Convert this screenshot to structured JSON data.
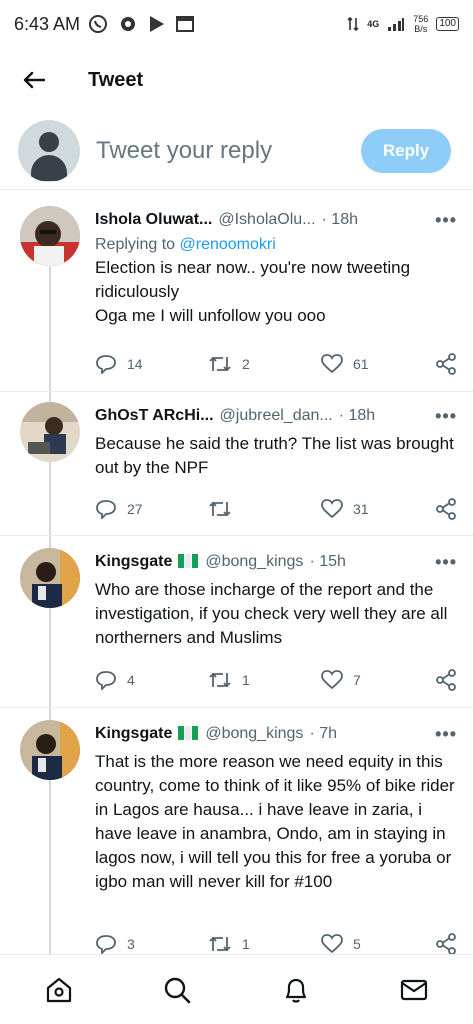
{
  "status_bar": {
    "time": "6:43 AM",
    "network": "4G",
    "speed_value": "756",
    "speed_unit": "B/s",
    "battery": "100"
  },
  "header": {
    "title": "Tweet"
  },
  "reply_bar": {
    "placeholder": "Tweet your reply",
    "button_label": "Reply"
  },
  "colors": {
    "accent": "#1d9bf0",
    "reply_button": "#8ecdf8",
    "secondary_text": "#536471"
  },
  "tweets": [
    {
      "name": "Ishola Oluwat...",
      "handle": "@IsholaOlu...",
      "time": "· 18h",
      "replying_prefix": "Replying to ",
      "replying_to": "@renoomokri",
      "lines": [
        "Election is near now.. you're now tweeting ridiculously",
        "Oga me I will unfollow you ooo"
      ],
      "replies": "14",
      "retweets": "2",
      "likes": "61"
    },
    {
      "name": "GhOsT ARcHi...",
      "handle": "@jubreel_dan...",
      "time": "· 18h",
      "lines": [
        "Because he said the truth? The list was brought out by the NPF"
      ],
      "replies": "27",
      "retweets": "",
      "likes": "31"
    },
    {
      "name": "Kingsgate",
      "handle": "@bong_kings",
      "time": "· 15h",
      "lines": [
        "Who are those incharge of the report and the investigation, if you check very well they are all northerners and Muslims"
      ],
      "replies": "4",
      "retweets": "1",
      "likes": "7"
    },
    {
      "name": "Kingsgate",
      "handle": "@bong_kings",
      "time": "· 7h",
      "lines": [
        "That is the more reason we need equity in this country, come to think of it like 95% of bike rider in Lagos are  hausa... i have leave in zaria, i have leave in anambra, Ondo, am in staying in lagos now, i will tell you this for free a yoruba or igbo man will never kill for #100"
      ],
      "replies": "3",
      "retweets": "1",
      "likes": "5"
    }
  ],
  "more_label": "•••",
  "icons": [
    "back-arrow-icon",
    "reply-icon",
    "retweet-icon",
    "like-icon",
    "share-icon",
    "home-icon",
    "search-icon",
    "notifications-icon",
    "messages-icon"
  ]
}
